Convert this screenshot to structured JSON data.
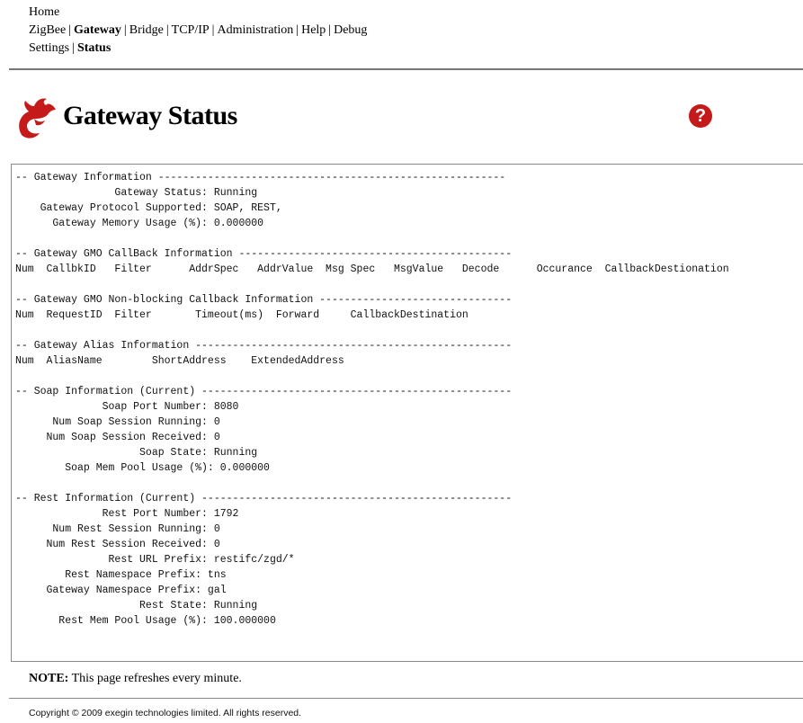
{
  "nav": {
    "home": "Home",
    "sep": "|",
    "row2": [
      "ZigBee",
      "Gateway",
      "Bridge",
      "TCP/IP",
      "Administration",
      "Help",
      "Debug"
    ],
    "row3": [
      "Settings",
      "Status"
    ]
  },
  "header": {
    "title": "Gateway Status",
    "logo_icon": "exegin-dragon-logo",
    "help_icon": "help-question-icon",
    "help_glyph": "?"
  },
  "status_text": "-- Gateway Information --------------------------------------------------------\n                Gateway Status: Running\n    Gateway Protocol Supported: SOAP, REST,\n      Gateway Memory Usage (%): 0.000000\n\n-- Gateway GMO CallBack Information --------------------------------------------\nNum  CallbkID   Filter      AddrSpec   AddrValue  Msg Spec   MsgValue   Decode      Occurance  CallbackDestionation\n\n-- Gateway GMO Non-blocking Callback Information -------------------------------\nNum  RequestID  Filter       Timeout(ms)  Forward     CallbackDestination\n\n-- Gateway Alias Information ---------------------------------------------------\nNum  AliasName        ShortAddress    ExtendedAddress\n\n-- Soap Information (Current) --------------------------------------------------\n              Soap Port Number: 8080\n      Num Soap Session Running: 0\n     Num Soap Session Received: 0\n                    Soap State: Running\n        Soap Mem Pool Usage (%): 0.000000\n\n-- Rest Information (Current) --------------------------------------------------\n              Rest Port Number: 1792\n      Num Rest Session Running: 0\n     Num Rest Session Received: 0\n               Rest URL Prefix: restifc/zgd/*\n        Rest Namespace Prefix: tns\n     Gateway Namespace Prefix: gal\n                    Rest State: Running\n       Rest Mem Pool Usage (%): 100.000000",
  "note": {
    "label": "NOTE:",
    "text": " This page refreshes every minute."
  },
  "footer": {
    "copyright": "Copyright © 2009 exegin technologies limited. All rights reserved."
  },
  "colors": {
    "brand_red": "#c51a1a",
    "rule_gray": "#777777"
  }
}
